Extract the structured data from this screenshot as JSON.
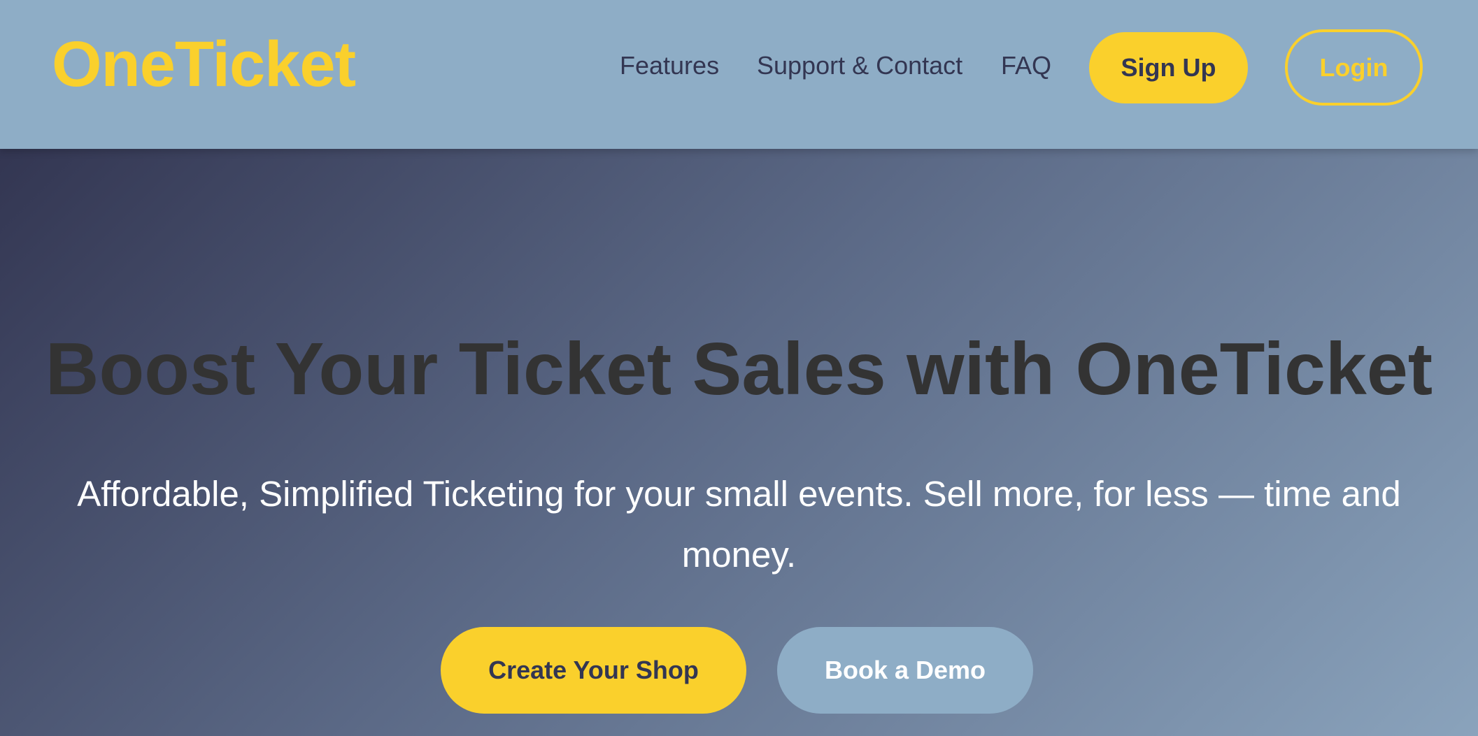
{
  "header": {
    "logo": "OneTicket",
    "nav": {
      "features": "Features",
      "support": "Support & Contact",
      "faq": "FAQ"
    },
    "signup_label": "Sign Up",
    "login_label": "Login"
  },
  "hero": {
    "title": "Boost Your Ticket Sales with OneTicket",
    "subtitle": "Affordable, Simplified Ticketing for your small events. Sell more, for less — time and money.",
    "primary_cta": "Create Your Shop",
    "secondary_cta": "Book a Demo"
  },
  "colors": {
    "accent": "#fad02c",
    "header_bg": "#8eadc6",
    "dark": "#333652"
  }
}
